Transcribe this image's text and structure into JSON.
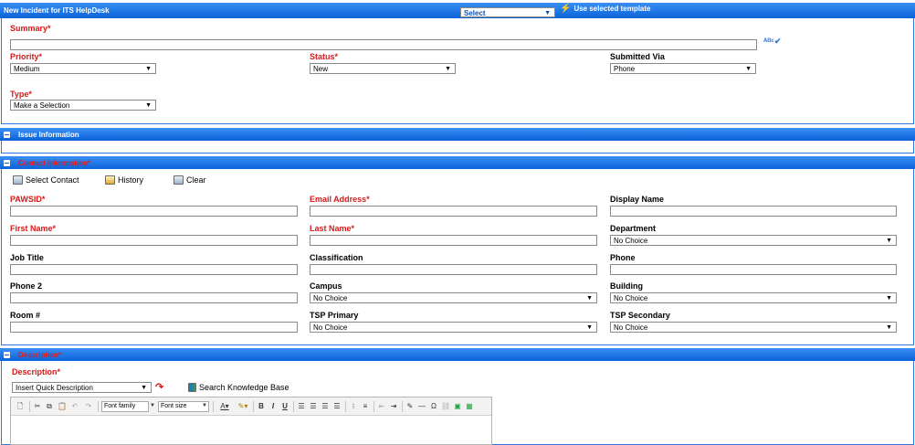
{
  "header": {
    "title": "New Incident for ITS HelpDesk",
    "template_select": "Select",
    "use_template_label": "Use selected template"
  },
  "form": {
    "summary_label": "Summary",
    "priority_label": "Priority",
    "priority_value": "Medium",
    "status_label": "Status",
    "status_value": "New",
    "submitted_via_label": "Submitted Via",
    "submitted_via_value": "Phone",
    "type_label": "Type",
    "type_value": "Make a Selection",
    "required_mark": "*"
  },
  "issue_section": {
    "title": "Issue Information"
  },
  "contact_section": {
    "title": "Contact Information",
    "select_contact": "Select Contact",
    "history": "History",
    "clear": "Clear",
    "pawsid_label": "PAWSID",
    "email_label": "Email Address",
    "display_name_label": "Display Name",
    "first_name_label": "First Name",
    "last_name_label": "Last Name",
    "department_label": "Department",
    "department_value": "No Choice",
    "job_title_label": "Job Title",
    "classification_label": "Classification",
    "phone_label": "Phone",
    "phone2_label": "Phone 2",
    "campus_label": "Campus",
    "campus_value": "No Choice",
    "building_label": "Building",
    "building_value": "No Choice",
    "room_label": "Room #",
    "tsp_primary_label": "TSP Primary",
    "tsp_primary_value": "No Choice",
    "tsp_secondary_label": "TSP Secondary",
    "tsp_secondary_value": "No Choice"
  },
  "description_section": {
    "title": "Description",
    "description_label": "Description",
    "quick_description": "Insert Quick Description",
    "search_kb": "Search Knowledge Base",
    "font_family": "Font family",
    "font_size": "Font size"
  }
}
